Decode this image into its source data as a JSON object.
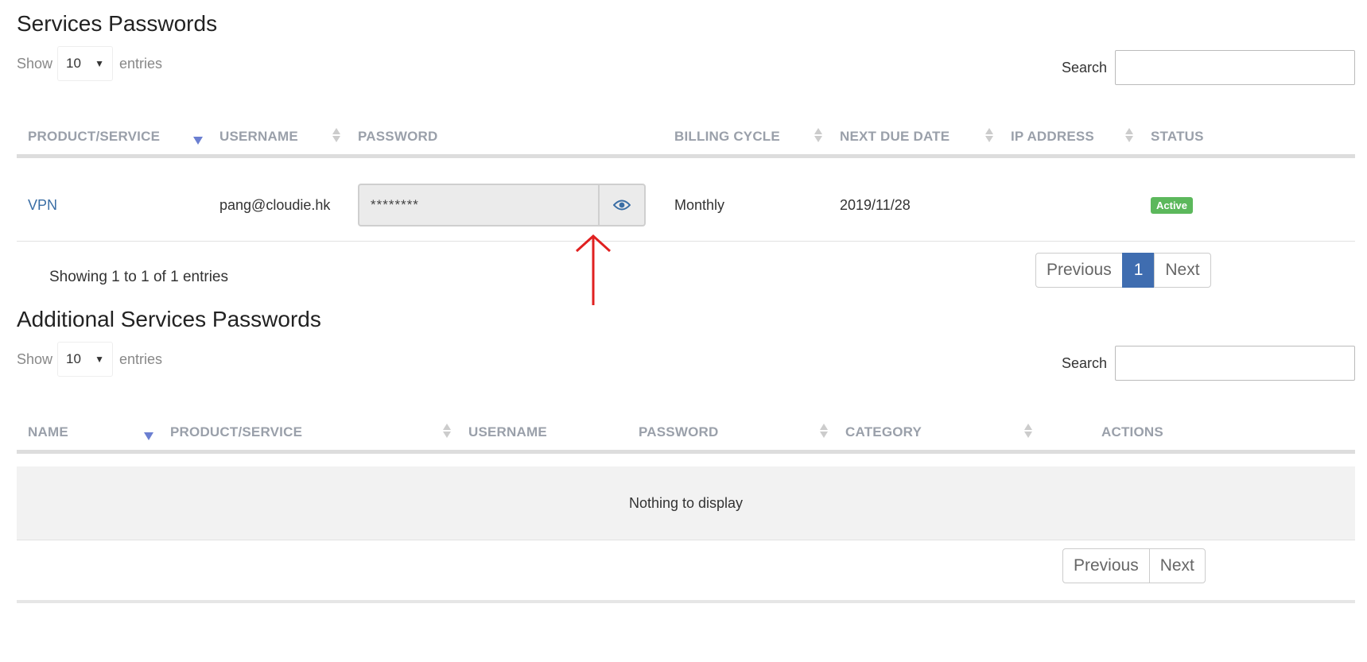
{
  "services": {
    "title": "Services Passwords",
    "length": {
      "show": "Show",
      "value": "10",
      "entries": "entries"
    },
    "search_label": "Search",
    "columns": {
      "product": "PRODUCT/SERVICE",
      "username": "USERNAME",
      "password": "PASSWORD",
      "billing": "BILLING CYCLE",
      "due": "NEXT DUE DATE",
      "ip": "IP ADDRESS",
      "status": "STATUS"
    },
    "rows": [
      {
        "product": "VPN",
        "username": "pang@cloudie.hk",
        "password": "********",
        "billing": "Monthly",
        "due": "2019/11/28",
        "ip": "",
        "status": "Active"
      }
    ],
    "info": "Showing 1 to 1 of 1 entries",
    "pagination": {
      "previous": "Previous",
      "page": "1",
      "next": "Next"
    }
  },
  "additional": {
    "title": "Additional Services Passwords",
    "length": {
      "show": "Show",
      "value": "10",
      "entries": "entries"
    },
    "search_label": "Search",
    "columns": {
      "name": "NAME",
      "product": "PRODUCT/SERVICE",
      "username": "USERNAME",
      "password": "PASSWORD",
      "category": "CATEGORY",
      "actions": "ACTIONS"
    },
    "empty": "Nothing to display",
    "pagination": {
      "previous": "Previous",
      "next": "Next"
    }
  },
  "colors": {
    "accent": "#3f6db0",
    "link": "#3a6ea5",
    "active_badge": "#5cb85c",
    "annotation_arrow": "#e02020"
  },
  "icons": {
    "reveal_password": "eye-icon",
    "sort": "sort-icon",
    "select_caret": "caret-down-icon"
  }
}
